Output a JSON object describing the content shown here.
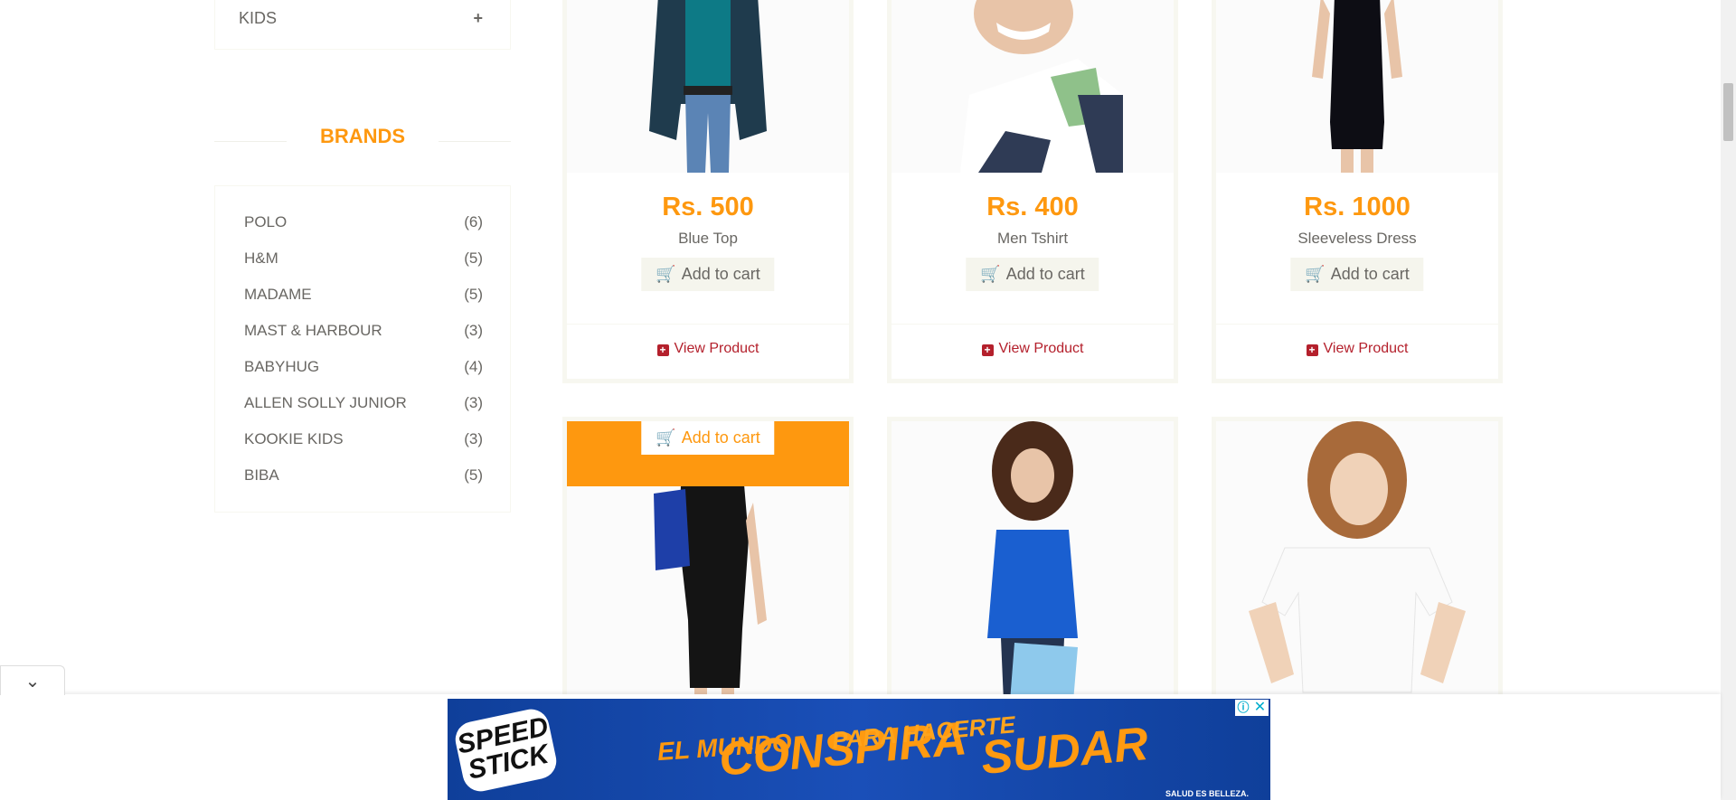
{
  "sidebar": {
    "category": {
      "label": "KIDS",
      "toggle": "+"
    },
    "brands_title": "BRANDS",
    "brands": [
      {
        "name": "POLO",
        "count": "(6)"
      },
      {
        "name": "H&M",
        "count": "(5)"
      },
      {
        "name": "MADAME",
        "count": "(5)"
      },
      {
        "name": "MAST & HARBOUR",
        "count": "(3)"
      },
      {
        "name": "BABYHUG",
        "count": "(4)"
      },
      {
        "name": "ALLEN SOLLY JUNIOR",
        "count": "(3)"
      },
      {
        "name": "KOOKIE KIDS",
        "count": "(3)"
      },
      {
        "name": "BIBA",
        "count": "(5)"
      }
    ]
  },
  "products": [
    {
      "price": "Rs. 500",
      "name": "Blue Top",
      "cart_label": "Add to cart",
      "view_label": "View Product"
    },
    {
      "price": "Rs. 400",
      "name": "Men Tshirt",
      "cart_label": "Add to cart",
      "view_label": "View Product"
    },
    {
      "price": "Rs. 1000",
      "name": "Sleeveless Dress",
      "cart_label": "Add to cart",
      "view_label": "View Product"
    }
  ],
  "hover_card": {
    "cart_label": "Add to cart"
  },
  "ad": {
    "logo": "SPEED STICK",
    "line1": "EL MUNDO",
    "line2": "CONSPIRA",
    "line3": "PARA HACERTE",
    "line4": "SUDAR",
    "tagline": "SALUD ES BELLEZA.",
    "info_icon": "ⓘ",
    "close_icon": "✕"
  },
  "colors": {
    "accent": "#fe980f",
    "link": "#b4202c",
    "text": "#696763",
    "ad_bg": "#1a4fb8"
  }
}
